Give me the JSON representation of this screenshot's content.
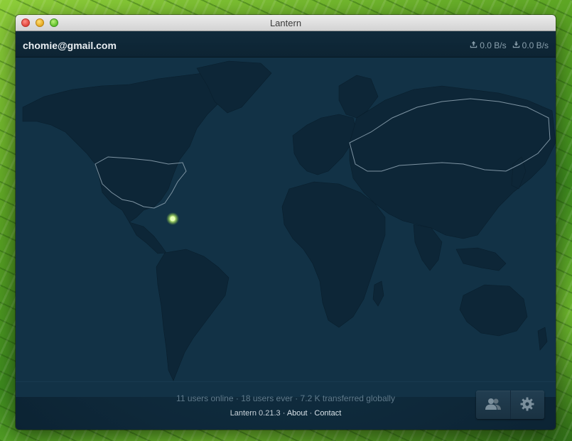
{
  "window": {
    "title": "Lantern"
  },
  "header": {
    "email": "chomie@gmail.com",
    "upload_rate": "0.0 B/s",
    "download_rate": "0.0 B/s"
  },
  "footer": {
    "stats": "11 users online · 18 users ever · 7.2 K transferred globally",
    "version": "Lantern 0.21.3",
    "separator": "·",
    "about_label": "About",
    "contact_label": "Contact"
  },
  "colors": {
    "accent_dot": "#c8f08a",
    "map_land": "#0d2637",
    "map_ocean": "#133548",
    "border_outline": "#6f8595"
  },
  "icons": {
    "upload": "upload-icon",
    "download": "download-icon",
    "friends": "users-icon",
    "settings": "gear-icon"
  }
}
